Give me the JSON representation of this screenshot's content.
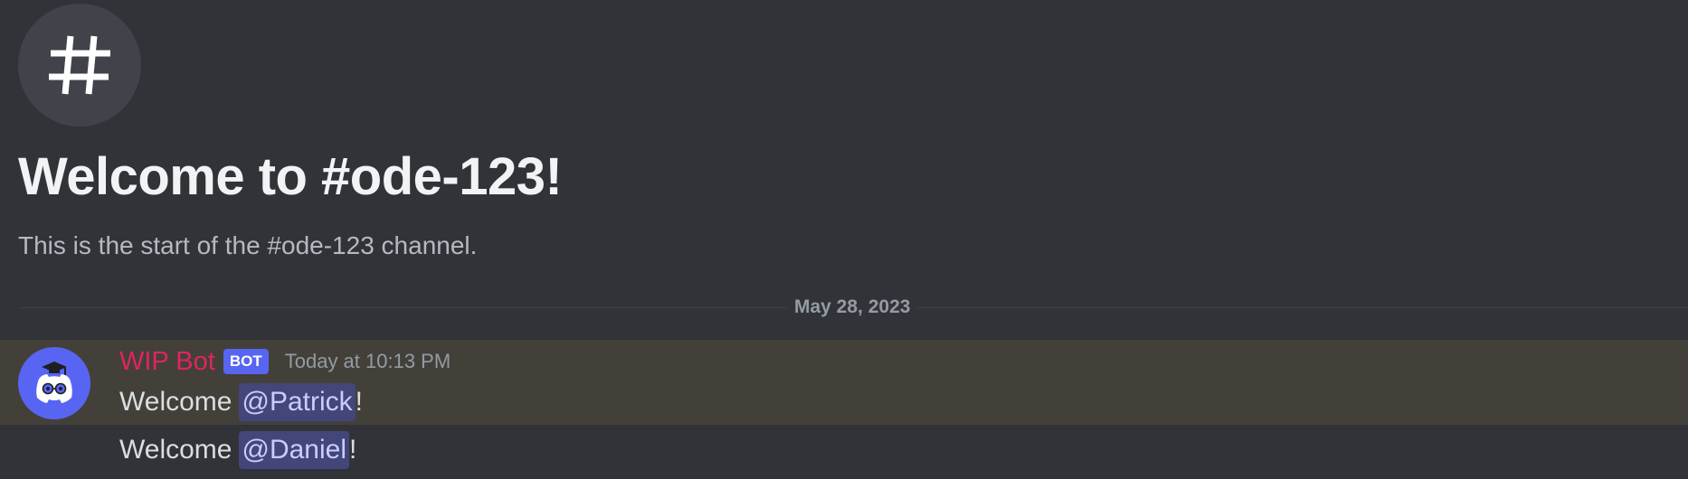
{
  "channel": {
    "icon": "hash-icon",
    "welcome_title": "Welcome to #ode-123!",
    "welcome_subtitle": "This is the start of the #ode-123 channel."
  },
  "date_divider": {
    "label": "May 28, 2023"
  },
  "message_group": {
    "author": {
      "name": "WIP Bot",
      "color": "#e0245e",
      "badge": "BOT",
      "avatar_icon": "discord-bot-avatar-icon"
    },
    "timestamp": "Today at 10:13 PM",
    "messages": [
      {
        "prefix": "Welcome",
        "mention": "@Patrick",
        "suffix": "!"
      },
      {
        "prefix": "Welcome",
        "mention": "@Daniel",
        "suffix": "!"
      }
    ]
  },
  "colors": {
    "background": "#313338",
    "highlighted_message": "#43403a",
    "accent": "#5865f2",
    "mention_bg": "#42467a"
  }
}
